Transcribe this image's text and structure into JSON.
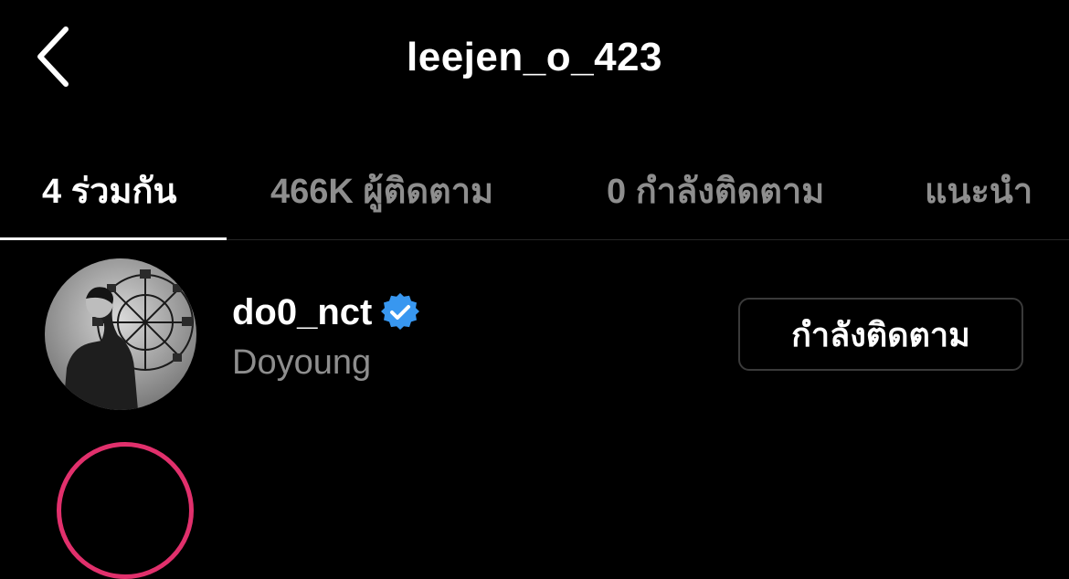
{
  "header": {
    "title": "leejen_o_423",
    "back_icon": "chevron-left-icon"
  },
  "tabs": [
    {
      "label": "4 ร่วมกัน",
      "active": true
    },
    {
      "label": "466K ผู้ติดตาม",
      "active": false
    },
    {
      "label": "0 กำลังติดตาม",
      "active": false
    },
    {
      "label": "แนะนำ",
      "active": false
    }
  ],
  "list": {
    "items": [
      {
        "username": "do0_nct",
        "verified": true,
        "display_name": "Doyoung",
        "button_label": "กำลังติดตาม"
      }
    ]
  },
  "colors": {
    "background": "#000000",
    "text": "#ffffff",
    "muted": "#8e8e8e",
    "verified_badge": "#3897f0",
    "story_ring": "#e1306c",
    "button_border": "#3a3a3a"
  }
}
